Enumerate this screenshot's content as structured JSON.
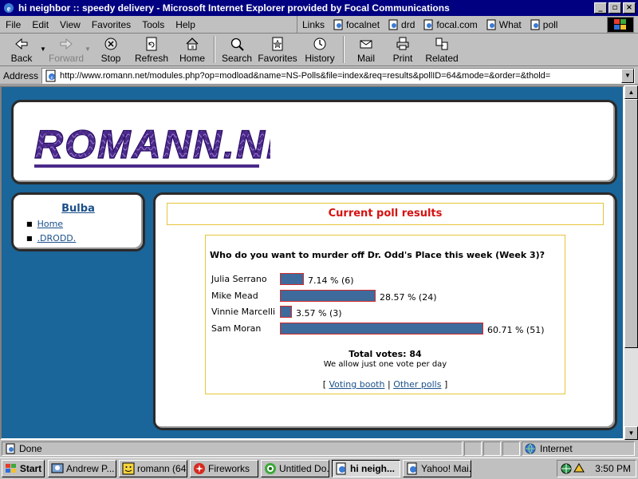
{
  "window": {
    "title": "hi neighbor :: speedy delivery - Microsoft Internet Explorer provided by Focal Communications",
    "minimize": "_",
    "maximize": "▫",
    "close": "×"
  },
  "menu": {
    "file": "File",
    "edit": "Edit",
    "view": "View",
    "favorites": "Favorites",
    "tools": "Tools",
    "help": "Help"
  },
  "links": {
    "label": "Links",
    "items": [
      "focalnet",
      "drd",
      "focal.com",
      "What",
      "poll"
    ]
  },
  "toolbar": {
    "back": "Back",
    "forward": "Forward",
    "stop": "Stop",
    "refresh": "Refresh",
    "home": "Home",
    "search": "Search",
    "favorites": "Favorites",
    "history": "History",
    "mail": "Mail",
    "print": "Print",
    "related": "Related"
  },
  "address": {
    "label": "Address",
    "url": "http://www.romann.net/modules.php?op=modload&name=NS-Polls&file=index&req=results&pollID=64&mode=&order=&thold="
  },
  "site": {
    "logo_text": "ROMANN.NET"
  },
  "sidebar": {
    "title": "Bulba",
    "items": [
      "Home",
      ".DRODD."
    ]
  },
  "poll": {
    "heading": "Current poll results",
    "question": "Who do you want to murder off Dr. Odd's Place this week (Week 3)?",
    "options": [
      {
        "name": "Julia Serrano",
        "percent": 7.14,
        "votes": 6,
        "label": "7.14 % (6)"
      },
      {
        "name": "Mike Mead",
        "percent": 28.57,
        "votes": 24,
        "label": "28.57 % (24)"
      },
      {
        "name": "Vinnie Marcelli",
        "percent": 3.57,
        "votes": 3,
        "label": "3.57 % (3)"
      },
      {
        "name": "Sam Moran",
        "percent": 60.71,
        "votes": 51,
        "label": "60.71 % (51)"
      }
    ],
    "total": "Total votes: 84",
    "notice": "We allow just one vote per day",
    "link_open": "[",
    "link_sep": "|",
    "link_close": "]",
    "voting_booth": "Voting booth",
    "other_polls": "Other polls"
  },
  "status": {
    "text": "Done",
    "zone": "Internet"
  },
  "taskbar": {
    "start": "Start",
    "tasks": [
      "Andrew P...",
      "romann (64...",
      "Fireworks",
      "Untitled Do...",
      "hi neigh...",
      "Yahoo! Mai..."
    ],
    "active_index": 4,
    "clock": "3:50 PM"
  },
  "colors": {
    "titlebar": "#000080",
    "page_bg": "#1a6599",
    "bar_fill": "#3e6a9c",
    "bar_border": "#d42b2b",
    "heading_red": "#d61010",
    "link_blue": "#1a4f8a",
    "box_border": "#e6c53a",
    "logo_purple": "#4b2a8a"
  }
}
